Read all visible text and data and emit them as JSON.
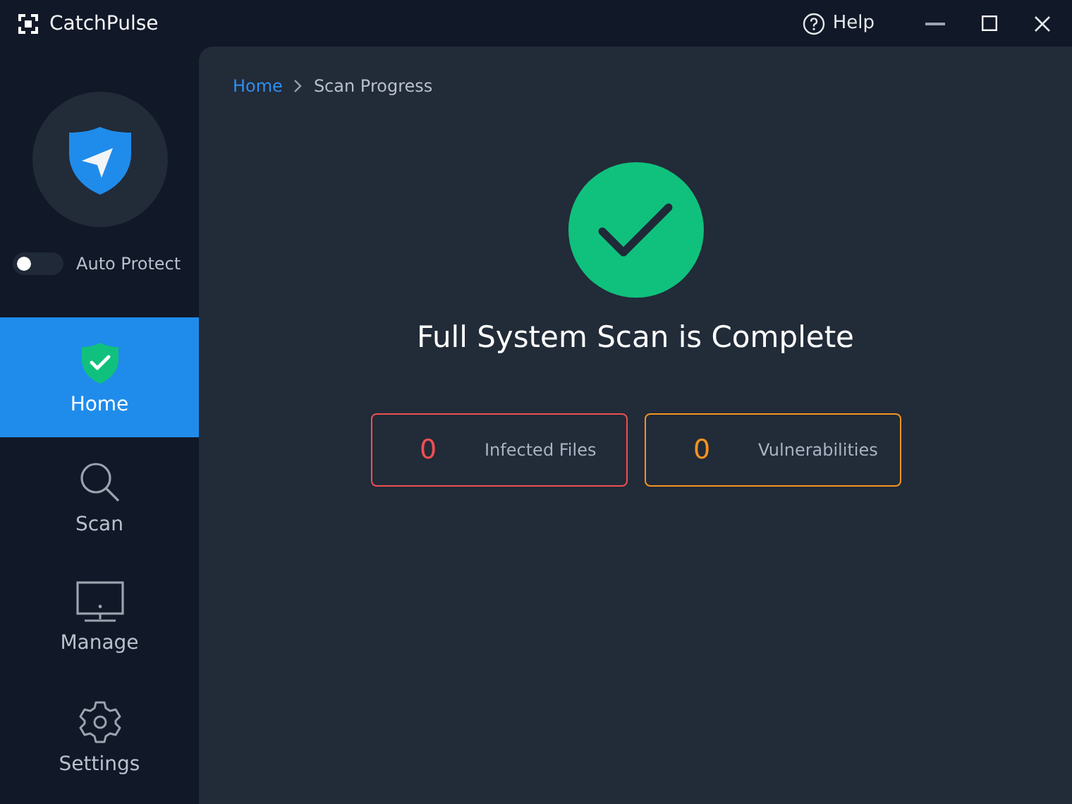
{
  "window": {
    "title": "CatchPulse",
    "help": "Help"
  },
  "sidebar": {
    "auto_protect": {
      "label": "Auto Protect",
      "on": false
    },
    "items": [
      {
        "label": "Home",
        "kind": "shield",
        "selected": true
      },
      {
        "label": "Scan",
        "kind": "search",
        "selected": false
      },
      {
        "label": "Manage",
        "kind": "monitor",
        "selected": false
      },
      {
        "label": "Settings",
        "kind": "gear",
        "selected": false
      }
    ]
  },
  "breadcrumb": [
    "Home",
    "Scan Progress"
  ],
  "status": {
    "title": "Full System Scan is Complete"
  },
  "stats": [
    {
      "count": "0",
      "label": "Infected Files",
      "color": "#ef4f52"
    },
    {
      "count": "0",
      "label": "Vulnerabilities",
      "color": "#f7931e"
    }
  ]
}
